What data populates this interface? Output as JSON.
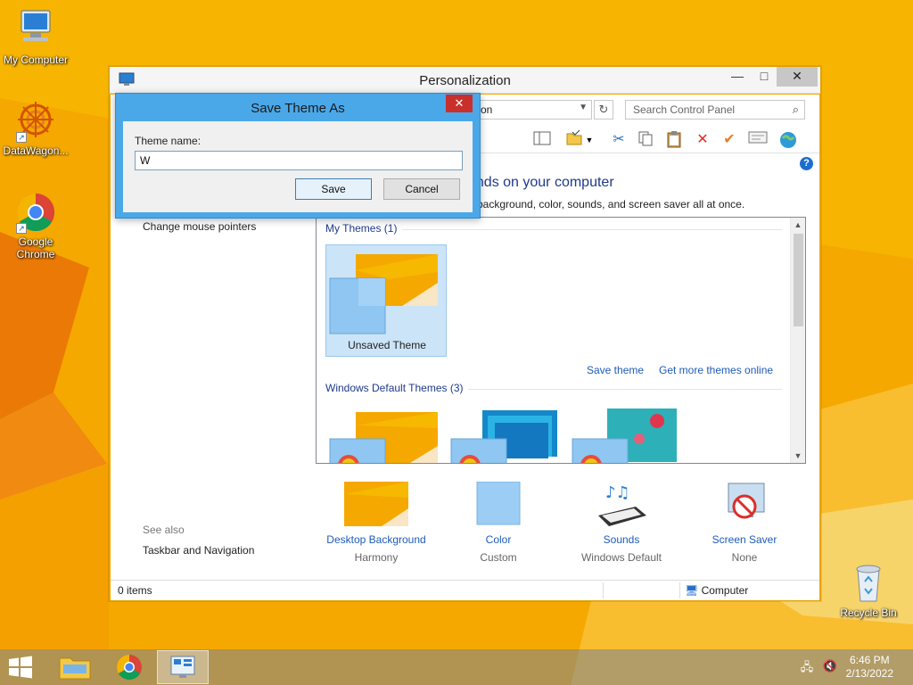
{
  "desktop": {
    "icons": [
      {
        "label": "My Computer"
      },
      {
        "label": "DataWagon..."
      },
      {
        "label": "Google Chrome"
      },
      {
        "label": "Recycle Bin"
      }
    ]
  },
  "window": {
    "title": "Personalization",
    "controls": {
      "minimize": "—",
      "maximize": "□",
      "close": "✕"
    },
    "address_fragment": "on",
    "search_placeholder": "Search Control Panel",
    "heading_fragment": "unds on your computer",
    "subheading_fragment": "p background, color, sounds, and screen saver all at once.",
    "left_links": [
      "Change mouse pointers"
    ],
    "see_also": {
      "label": "See also",
      "links": [
        "Taskbar and Navigation"
      ]
    },
    "themes": {
      "my_themes_label": "My Themes (1)",
      "unsaved_theme_name": "Unsaved Theme",
      "save_theme_link": "Save theme",
      "get_more_link": "Get more themes online",
      "default_themes_label": "Windows Default Themes (3)"
    },
    "quick_items": [
      {
        "title": "Desktop Background",
        "value": "Harmony"
      },
      {
        "title": "Color",
        "value": "Custom"
      },
      {
        "title": "Sounds",
        "value": "Windows Default"
      },
      {
        "title": "Screen Saver",
        "value": "None"
      }
    ],
    "status": {
      "items": "0 items",
      "location": "Computer"
    }
  },
  "dialog": {
    "title": "Save Theme As",
    "close": "✕",
    "field_label": "Theme name:",
    "field_value": "W",
    "save_label": "Save",
    "cancel_label": "Cancel"
  },
  "taskbar": {
    "time": "6:46 PM",
    "date": "2/13/2022"
  },
  "colors": {
    "accent": "#4aa8e8",
    "link": "#1e5bb8",
    "heading": "#1e3a8a",
    "desktop": "#f5a800"
  }
}
